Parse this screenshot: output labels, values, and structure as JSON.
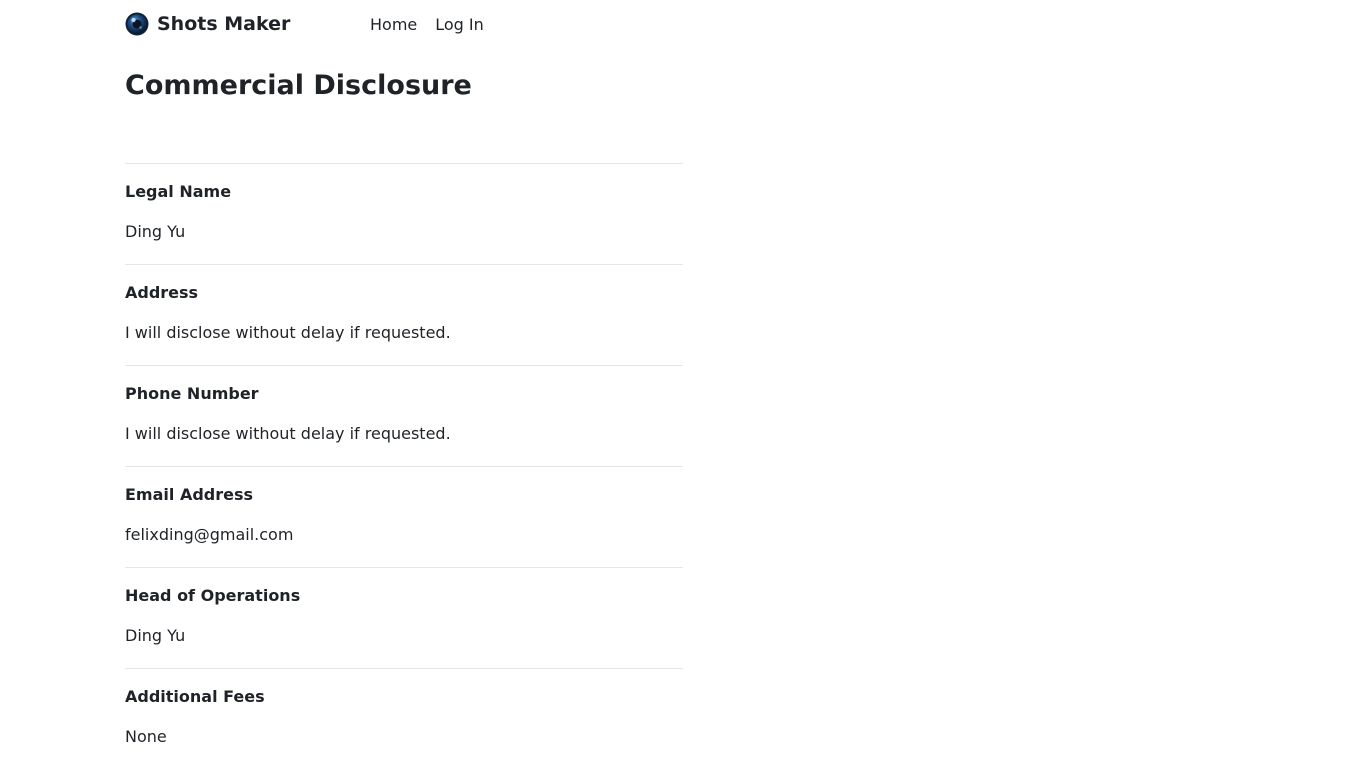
{
  "header": {
    "brand_name": "Shots Maker",
    "logo_icon": "camera-lens-icon",
    "nav": [
      {
        "label": "Home"
      },
      {
        "label": "Log In"
      }
    ]
  },
  "page": {
    "title": "Commercial Disclosure"
  },
  "disclosure": [
    {
      "label": "Legal Name",
      "value": "Ding Yu"
    },
    {
      "label": "Address",
      "value": "I will disclose without delay if requested."
    },
    {
      "label": "Phone Number",
      "value": "I will disclose without delay if requested."
    },
    {
      "label": "Email Address",
      "value": "felixding@gmail.com"
    },
    {
      "label": "Head of Operations",
      "value": "Ding Yu"
    },
    {
      "label": "Additional Fees",
      "value": "None"
    }
  ]
}
